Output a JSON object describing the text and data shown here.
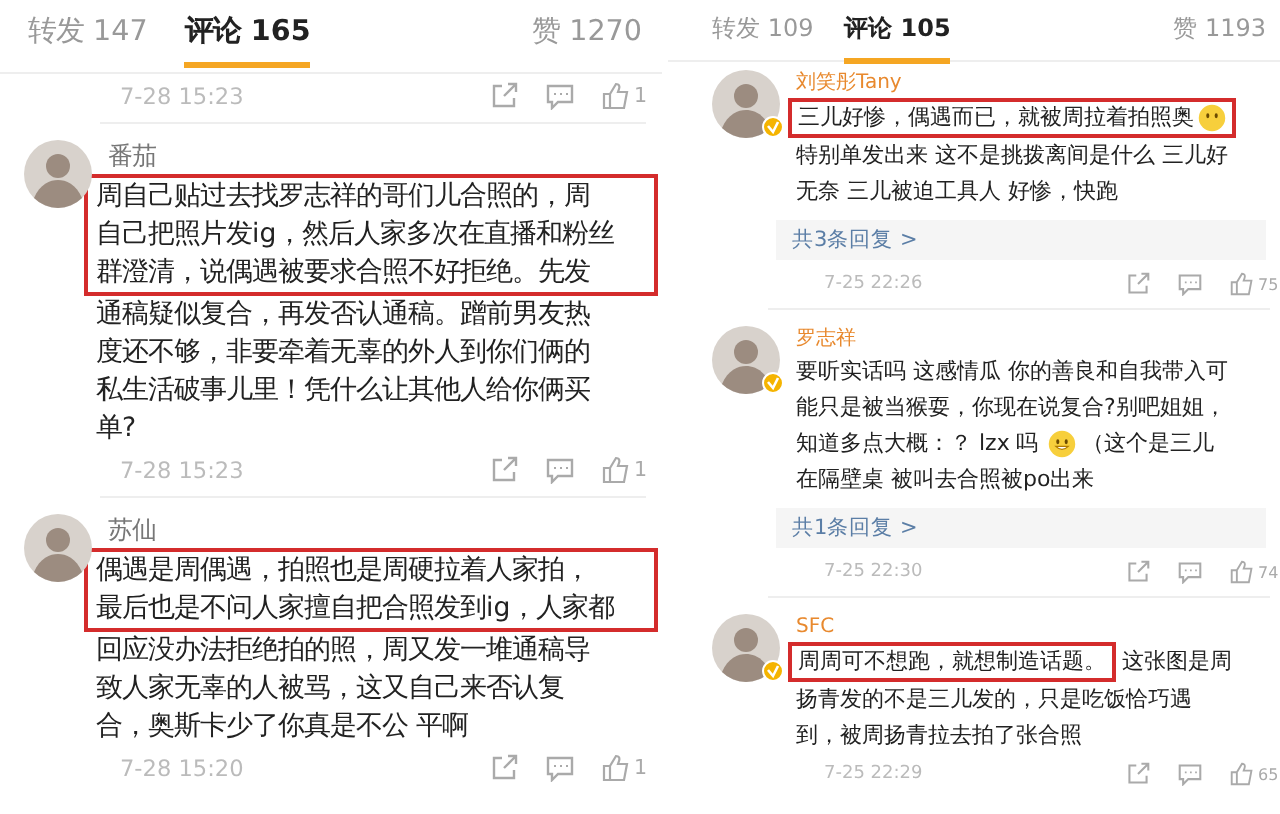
{
  "panels": [
    {
      "tabs": [
        {
          "label": "转发 147",
          "selected": false
        },
        {
          "label": "评论 165",
          "selected": true
        },
        {
          "label": "赞 1270",
          "selected": false
        }
      ],
      "items": [
        {
          "kind": "meta",
          "time": "7-28 15:23",
          "likes": "1"
        },
        {
          "kind": "comment",
          "name": "番茄",
          "verified": false,
          "body": [
            {
              "kind": "box",
              "lines": [
                "周自己贴过去找罗志祥的哥们儿合照的，周",
                "自己把照片发ig，然后人家多次在直播和粉丝",
                "群澄清，说偶遇被要求合照不好拒绝。先发"
              ]
            },
            {
              "kind": "line",
              "parts": [
                {
                  "kind": "text",
                  "text": "通稿疑似复合，再发否认通稿。蹭前男友热"
                }
              ]
            },
            {
              "kind": "line",
              "parts": [
                {
                  "kind": "text",
                  "text": "度还不够，非要牵着无辜的外人到你们俩的"
                }
              ]
            },
            {
              "kind": "line",
              "parts": [
                {
                  "kind": "text",
                  "text": "私生活破事儿里！凭什么让其他人给你俩买"
                }
              ]
            },
            {
              "kind": "line",
              "parts": [
                {
                  "kind": "text",
                  "text": "单?"
                }
              ]
            }
          ],
          "time": "7-28 15:23",
          "likes": "1"
        },
        {
          "kind": "comment",
          "name": "苏仙",
          "verified": false,
          "body": [
            {
              "kind": "box",
              "lines": [
                "偶遇是周偶遇，拍照也是周硬拉着人家拍，",
                "最后也是不问人家擅自把合照发到ig，人家都"
              ]
            },
            {
              "kind": "line",
              "parts": [
                {
                  "kind": "text",
                  "text": "回应没办法拒绝拍的照，周又发一堆通稿导"
                }
              ]
            },
            {
              "kind": "line",
              "parts": [
                {
                  "kind": "text",
                  "text": "致人家无辜的人被骂，这又自己来否认复"
                }
              ]
            },
            {
              "kind": "line",
              "parts": [
                {
                  "kind": "text",
                  "text": "合，奥斯卡少了你真是不公 平啊"
                }
              ]
            }
          ],
          "time": "7-28 15:20",
          "likes": "1"
        }
      ]
    },
    {
      "tabs": [
        {
          "label": "转发 109",
          "selected": false
        },
        {
          "label": "评论 105",
          "selected": true
        },
        {
          "label": "赞 1193",
          "selected": false
        }
      ],
      "items": [
        {
          "kind": "comment",
          "name": "刘笑彤Tany",
          "verified": true,
          "body": [
            {
              "kind": "line",
              "parts": [
                {
                  "kind": "highlight",
                  "parts": [
                    {
                      "kind": "text",
                      "text": "三儿好惨，偶遇而已，就被周拉着拍照奥"
                    },
                    {
                      "kind": "emoji_blank"
                    }
                  ]
                }
              ]
            },
            {
              "kind": "line",
              "parts": [
                {
                  "kind": "text",
                  "text": "特别单发出来 这不是挑拨离间是什么 三儿好"
                }
              ]
            },
            {
              "kind": "line",
              "parts": [
                {
                  "kind": "text",
                  "text": "无奈 三儿被迫工具人 好惨，快跑"
                }
              ]
            }
          ],
          "replies": "共3条回复 >",
          "time": "7-25 22:26",
          "likes": "75"
        },
        {
          "kind": "comment",
          "name": "罗志祥",
          "verified": true,
          "body": [
            {
              "kind": "line",
              "parts": [
                {
                  "kind": "text",
                  "text": "要听实话吗 这感情瓜 你的善良和自我带入可"
                }
              ]
            },
            {
              "kind": "line",
              "parts": [
                {
                  "kind": "text",
                  "text": "能只是被当猴耍，你现在说复合?别吧姐姐，"
                }
              ]
            },
            {
              "kind": "line",
              "parts": [
                {
                  "kind": "text",
                  "text": "知道多点大概：？ lzx"
                },
                {
                  "kind": "text",
                  "text": "吗"
                },
                {
                  "kind": "emoji_grin"
                },
                {
                  "kind": "text",
                  "text": "（这个是三儿"
                }
              ]
            },
            {
              "kind": "line",
              "parts": [
                {
                  "kind": "text",
                  "text": "在隔壁桌 被叫去合照被po出来"
                }
              ]
            }
          ],
          "replies": "共1条回复 >",
          "time": "7-25 22:30",
          "likes": "74"
        },
        {
          "kind": "comment",
          "name": "SFC",
          "verified": true,
          "body": [
            {
              "kind": "line",
              "parts": [
                {
                  "kind": "highlight",
                  "parts": [
                    {
                      "kind": "text",
                      "text": "周周可不想跑，就想制造话题。"
                    }
                  ]
                },
                {
                  "kind": "text",
                  "text": "这张图是周"
                }
              ]
            },
            {
              "kind": "line",
              "parts": [
                {
                  "kind": "text",
                  "text": "扬青发的不是三儿发的，只是吃饭恰巧遇"
                }
              ]
            },
            {
              "kind": "line",
              "parts": [
                {
                  "kind": "text",
                  "text": "到，被周扬青拉去拍了张合照"
                }
              ]
            }
          ],
          "time": "7-25 22:29",
          "likes": "65"
        }
      ]
    }
  ]
}
